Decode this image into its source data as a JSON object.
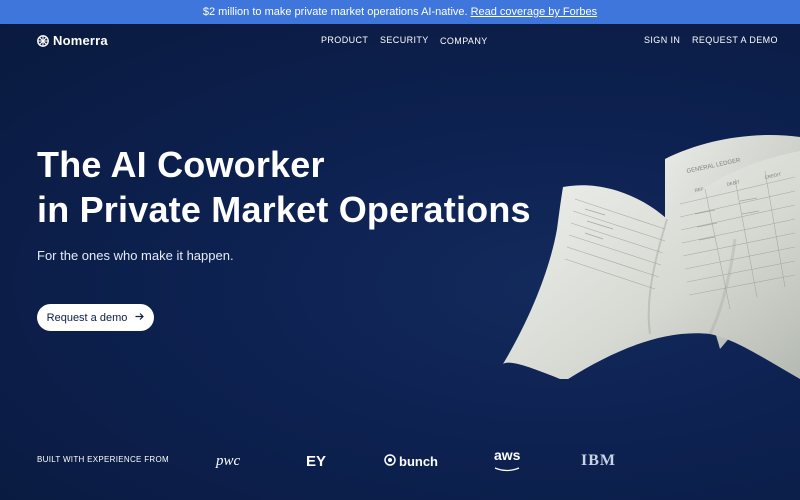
{
  "announcement": {
    "text": "$2 million to make private market operations AI-native.",
    "link": "Read coverage by Forbes"
  },
  "nav": {
    "brand": "Nomerra",
    "items": [
      "PRODUCT",
      "SECURITY",
      "COMPANY"
    ],
    "sign_in": "SIGN IN",
    "request_demo": "REQUEST A DEMO"
  },
  "hero": {
    "headline_line1": "The AI Coworker",
    "headline_line2": "in Private Market Operations",
    "subtitle": "For the ones who make it happen.",
    "cta_label": "Request a demo",
    "cta_icon": "arrow-right-icon",
    "ledger_title": "GENERAL LEDGER",
    "ledger_columns": [
      "REF",
      "DEBIT",
      "CREDIT"
    ]
  },
  "partners": {
    "label": "BUILT WITH EXPERIENCE FROM",
    "logos": [
      "pwc",
      "EY",
      "bunch",
      "aws",
      "IBM"
    ]
  },
  "colors": {
    "announcement_bg": "#3f76db",
    "hero_bg": "#0b1e45",
    "cta_bg": "#ffffff"
  }
}
